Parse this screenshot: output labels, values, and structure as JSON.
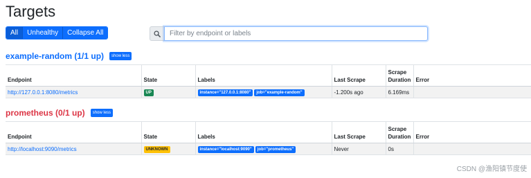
{
  "page": {
    "title": "Targets"
  },
  "filters": {
    "all": "All",
    "unhealthy": "Unhealthy",
    "collapse_all": "Collapse All"
  },
  "search": {
    "placeholder": "Filter by endpoint or labels",
    "value": ""
  },
  "columns": {
    "endpoint": "Endpoint",
    "state": "State",
    "labels": "Labels",
    "last_scrape": "Last Scrape",
    "scrape_duration_1": "Scrape",
    "scrape_duration_2": "Duration",
    "error": "Error"
  },
  "pools": [
    {
      "title": "example-random (1/1 up)",
      "toggle": "show less",
      "status": "up",
      "row": {
        "endpoint": "http://127.0.0.1:8080/metrics",
        "state": "UP",
        "label_instance": "instance=\"127.0.0.1:8080\"",
        "label_job": "job=\"example-random\"",
        "last_scrape": "-1.200s ago",
        "duration": "6.169ms",
        "error": ""
      }
    },
    {
      "title": "prometheus (0/1 up)",
      "toggle": "show less",
      "status": "down",
      "row": {
        "endpoint": "http://localhost:9090/metrics",
        "state": "UNKNOWN",
        "label_instance": "instance=\"localhost:9090\"",
        "label_job": "job=\"prometheus\"",
        "last_scrape": "Never",
        "duration": "0s",
        "error": ""
      }
    }
  ],
  "watermark": "CSDN @渔阳镇节度使",
  "colors": {
    "primary": "#0d6efd",
    "success": "#198754",
    "warning": "#ffc107",
    "danger": "#dc3545"
  }
}
